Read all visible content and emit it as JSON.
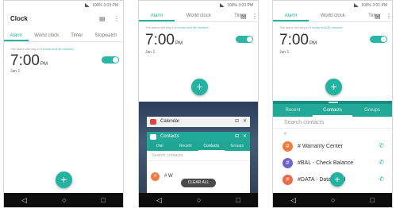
{
  "p1": {
    "status": "100% 3:03 PM",
    "title": "Clock",
    "tabs": [
      "Alarm",
      "World clock",
      "Timer",
      "Stopwatch"
    ],
    "note_lead": "The alarm will ring in ",
    "note_link": "9 hours and 56 minutes",
    "time": "7:00",
    "ampm": "PM",
    "date": "Jan 1",
    "fab": "+"
  },
  "p2": {
    "status": "100% 3:03 PM",
    "tabs": [
      "Alarm",
      "World clock",
      "Timer"
    ],
    "note_lead": "The alarm will ring in ",
    "note_link": "9 hours and 56 minutes",
    "time": "7:00",
    "ampm": "PM",
    "date": "Jan 1",
    "fab": "+",
    "card1": "Calendar",
    "card2": "Contacts",
    "card_tabs": [
      "Dial",
      "Recent",
      "Contacts",
      "Groups"
    ],
    "search": "Search contacts",
    "partial_contact": "# W",
    "clear_all": "CLEAR ALL"
  },
  "p3": {
    "status": "100% 3:01 PM",
    "tabs": [
      "Alarm",
      "World clock",
      "Timer"
    ],
    "note_lead": "The alarm will ring in ",
    "note_link": "9 hours and 56 minutes",
    "time": "7:00",
    "ampm": "PM",
    "date": "Jan 1",
    "fab": "+",
    "contact_tabs": [
      "Recent",
      "Contacts",
      "Groups"
    ],
    "search": "Search contacts",
    "index": "#",
    "contacts": [
      {
        "name": "# Warranty Center",
        "initial": "#",
        "color": "#f07b3f"
      },
      {
        "name": "#BAL - Check Balance",
        "initial": "#",
        "color": "#6f64c8"
      },
      {
        "name": "#DATA - Data Used",
        "initial": "#",
        "color": "#f06a4a"
      }
    ]
  },
  "nav": {
    "back": "◁",
    "home": "○",
    "recents": "□"
  },
  "colors": {
    "accent": "#22b3a3",
    "nav": "#0d0d0d"
  }
}
